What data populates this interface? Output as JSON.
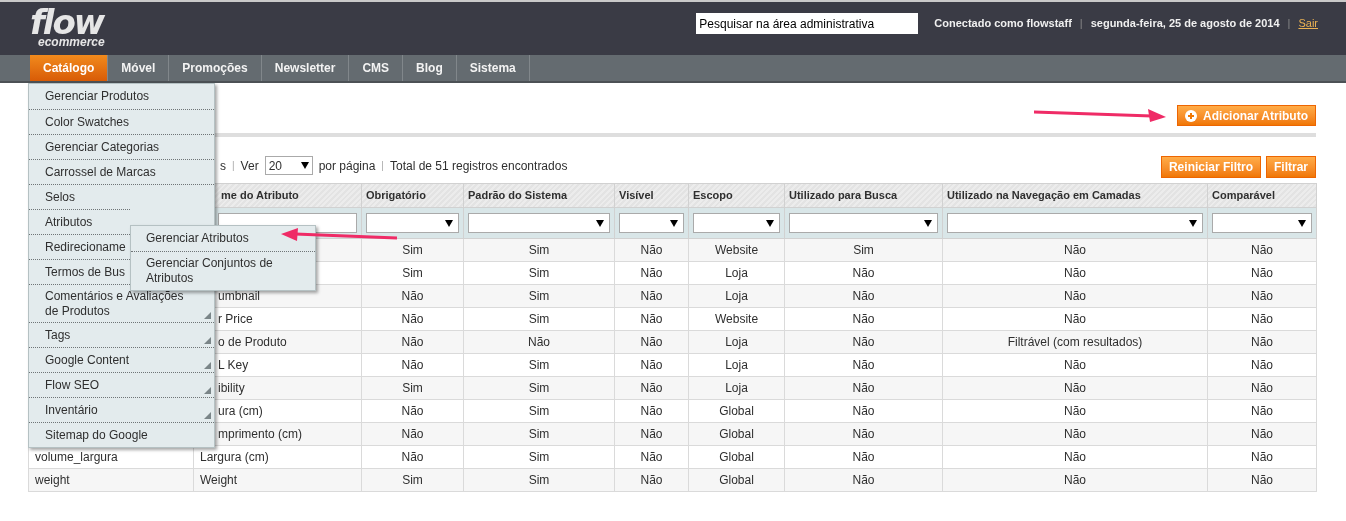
{
  "header": {
    "logo": {
      "main": "flow",
      "sub": "ecommerce"
    },
    "search": {
      "placeholder": "Pesquisar na área administrativa"
    },
    "user": "Conectado como flowstaff",
    "separators": [
      "|",
      "|"
    ],
    "date": "segunda-feira, 25 de agosto de 2014",
    "logout": "Sair"
  },
  "nav": [
    {
      "label": "Catálogo",
      "selected": true
    },
    {
      "label": "Móvel",
      "selected": false
    },
    {
      "label": "Promoções",
      "selected": false
    },
    {
      "label": "Newsletter",
      "selected": false
    },
    {
      "label": "CMS",
      "selected": false
    },
    {
      "label": "Blog",
      "selected": false
    },
    {
      "label": "Sistema",
      "selected": false
    }
  ],
  "menu": [
    {
      "label": "Gerenciar Produtos",
      "arrow": false
    },
    {
      "label": "Color Swatches",
      "arrow": false
    },
    {
      "label": "Gerenciar Categorias",
      "arrow": false
    },
    {
      "label": "Carrossel de Marcas",
      "arrow": false
    },
    {
      "label": "Selos",
      "arrow": false
    },
    {
      "label": "Atributos",
      "arrow": false,
      "children": [
        {
          "label": "Gerenciar Atributos"
        },
        {
          "label": "Gerenciar Conjuntos de Atributos"
        }
      ]
    },
    {
      "label": "Redirecioname",
      "arrow": false
    },
    {
      "label": "Termos de Bus",
      "arrow": false
    },
    {
      "label": "Comentários e Avaliações de Produtos",
      "arrow": true
    },
    {
      "label": "Tags",
      "arrow": true
    },
    {
      "label": "Google Content",
      "arrow": true
    },
    {
      "label": "Flow SEO",
      "arrow": true
    },
    {
      "label": "Inventário",
      "arrow": true
    },
    {
      "label": "Sitemap do Google",
      "arrow": false
    }
  ],
  "add_button": "Adicionar Atributo",
  "pager": {
    "fragment": "s",
    "separators": [
      "|",
      "|"
    ],
    "view_label": "Ver",
    "per_page": "20",
    "per_page_label": "por página",
    "total": "Total de 51 registros encontrados"
  },
  "filter_buttons": [
    "Reiniciar Filtro",
    "Filtrar"
  ],
  "table": {
    "columns": [
      "me do Atributo",
      "Obrigatório",
      "Padrão do Sistema",
      "Visível",
      "Escopo",
      "Utilizado para Busca",
      "Utilizado na Navegação em Camadas",
      "Comparável"
    ],
    "rows": [
      {
        "values": [
          "Sim",
          "Sim",
          "Não",
          "Website",
          "Sim",
          "Não",
          "Não"
        ]
      },
      {
        "values": [
          "Sim",
          "Sim",
          "Não",
          "Loja",
          "Não",
          "Não",
          "Não"
        ]
      },
      {
        "label": "umbnail",
        "values": [
          "Não",
          "Sim",
          "Não",
          "Loja",
          "Não",
          "Não",
          "Não"
        ]
      },
      {
        "label": "r Price",
        "values": [
          "Não",
          "Sim",
          "Não",
          "Website",
          "Não",
          "Não",
          "Não"
        ]
      },
      {
        "label": "o de Produto",
        "values": [
          "Não",
          "Não",
          "Não",
          "Loja",
          "Não",
          "Filtrável (com resultados)",
          "Não"
        ]
      },
      {
        "label": "L Key",
        "values": [
          "Não",
          "Sim",
          "Não",
          "Loja",
          "Não",
          "Não",
          "Não"
        ]
      },
      {
        "label": "ibility",
        "values": [
          "Sim",
          "Sim",
          "Não",
          "Loja",
          "Não",
          "Não",
          "Não"
        ]
      },
      {
        "label": "ura (cm)",
        "values": [
          "Não",
          "Sim",
          "Não",
          "Global",
          "Não",
          "Não",
          "Não"
        ]
      },
      {
        "label": "mprimento (cm)",
        "values": [
          "Não",
          "Sim",
          "Não",
          "Global",
          "Não",
          "Não",
          "Não"
        ]
      },
      {
        "code": "volume_largura",
        "label": "Largura (cm)",
        "values": [
          "Não",
          "Sim",
          "Não",
          "Global",
          "Não",
          "Não",
          "Não"
        ]
      },
      {
        "code": "weight",
        "label": "Weight",
        "values": [
          "Sim",
          "Sim",
          "Não",
          "Global",
          "Não",
          "Não",
          "Não"
        ]
      }
    ]
  }
}
